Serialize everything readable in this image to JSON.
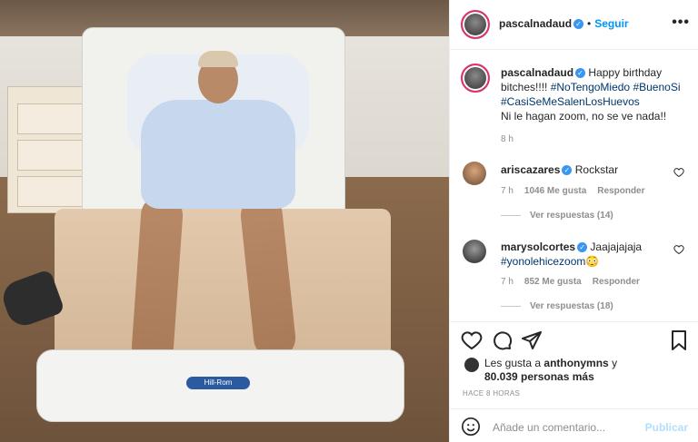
{
  "post": {
    "username": "pascalnadaud",
    "follow_label": "Seguir",
    "more_label": "•••"
  },
  "caption": {
    "username": "pascalnadaud",
    "text_1": "Happy birthday bitches!!!!",
    "tags": [
      "#NoTengoMiedo",
      "#BuenoSi",
      "#CasiSeMeSalenLosHuevos"
    ],
    "text_2": "Ni le hagan zoom, no se ve nada!!",
    "time": "8 h"
  },
  "comments": [
    {
      "username": "ariscazares",
      "text": "Rockstar",
      "time": "7 h",
      "likes": "1046 Me gusta",
      "reply_label": "Responder",
      "view_replies": "Ver respuestas (14)"
    },
    {
      "username": "marysolcortes",
      "text": "Jaajajajaja",
      "tag": "#yonolehicezoom",
      "emoji": "😳",
      "time": "7 h",
      "likes": "852 Me gusta",
      "reply_label": "Responder",
      "view_replies": "Ver respuestas (18)"
    }
  ],
  "likes": {
    "prefix": "Les gusta a",
    "user": "anthonymns",
    "suffix": "y",
    "count": "80.039 personas más"
  },
  "posted_ago": "HACE 8 HORAS",
  "add_comment": {
    "placeholder": "Añade un comentario...",
    "publish_label": "Publicar"
  },
  "photo": {
    "bed_brand": "Hill-Rom"
  }
}
